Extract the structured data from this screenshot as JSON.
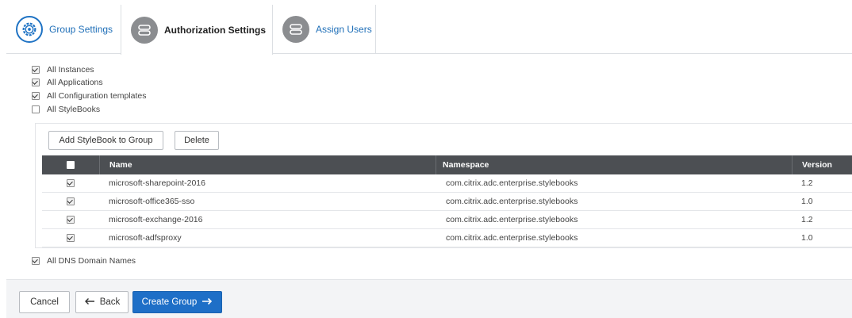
{
  "tabs": [
    {
      "label": "Group Settings",
      "icon": "gear-icon"
    },
    {
      "label": "Authorization Settings",
      "icon": "server-icon"
    },
    {
      "label": "Assign Users",
      "icon": "server-icon"
    }
  ],
  "options": {
    "all_instances": {
      "label": "All Instances",
      "checked": true
    },
    "all_applications": {
      "label": "All Applications",
      "checked": true
    },
    "all_config_templates": {
      "label": "All Configuration templates",
      "checked": true
    },
    "all_stylebooks": {
      "label": "All StyleBooks",
      "checked": false
    },
    "all_dns": {
      "label": "All DNS Domain Names",
      "checked": true
    }
  },
  "stylebooks": {
    "add_label": "Add StyleBook to Group",
    "delete_label": "Delete",
    "columns": {
      "name": "Name",
      "namespace": "Namespace",
      "version": "Version"
    },
    "rows": [
      {
        "name": "microsoft-sharepoint-2016",
        "namespace": "com.citrix.adc.enterprise.stylebooks",
        "version": "1.2",
        "checked": true
      },
      {
        "name": "microsoft-office365-sso",
        "namespace": "com.citrix.adc.enterprise.stylebooks",
        "version": "1.0",
        "checked": true
      },
      {
        "name": "microsoft-exchange-2016",
        "namespace": "com.citrix.adc.enterprise.stylebooks",
        "version": "1.2",
        "checked": true
      },
      {
        "name": "microsoft-adfsproxy",
        "namespace": "com.citrix.adc.enterprise.stylebooks",
        "version": "1.0",
        "checked": true
      }
    ]
  },
  "footer": {
    "cancel_label": "Cancel",
    "back_label": "Back",
    "create_label": "Create Group"
  },
  "colors": {
    "accent": "#1e6fc7",
    "table_header": "#4c4f53",
    "footer_bg": "#f3f4f6"
  }
}
